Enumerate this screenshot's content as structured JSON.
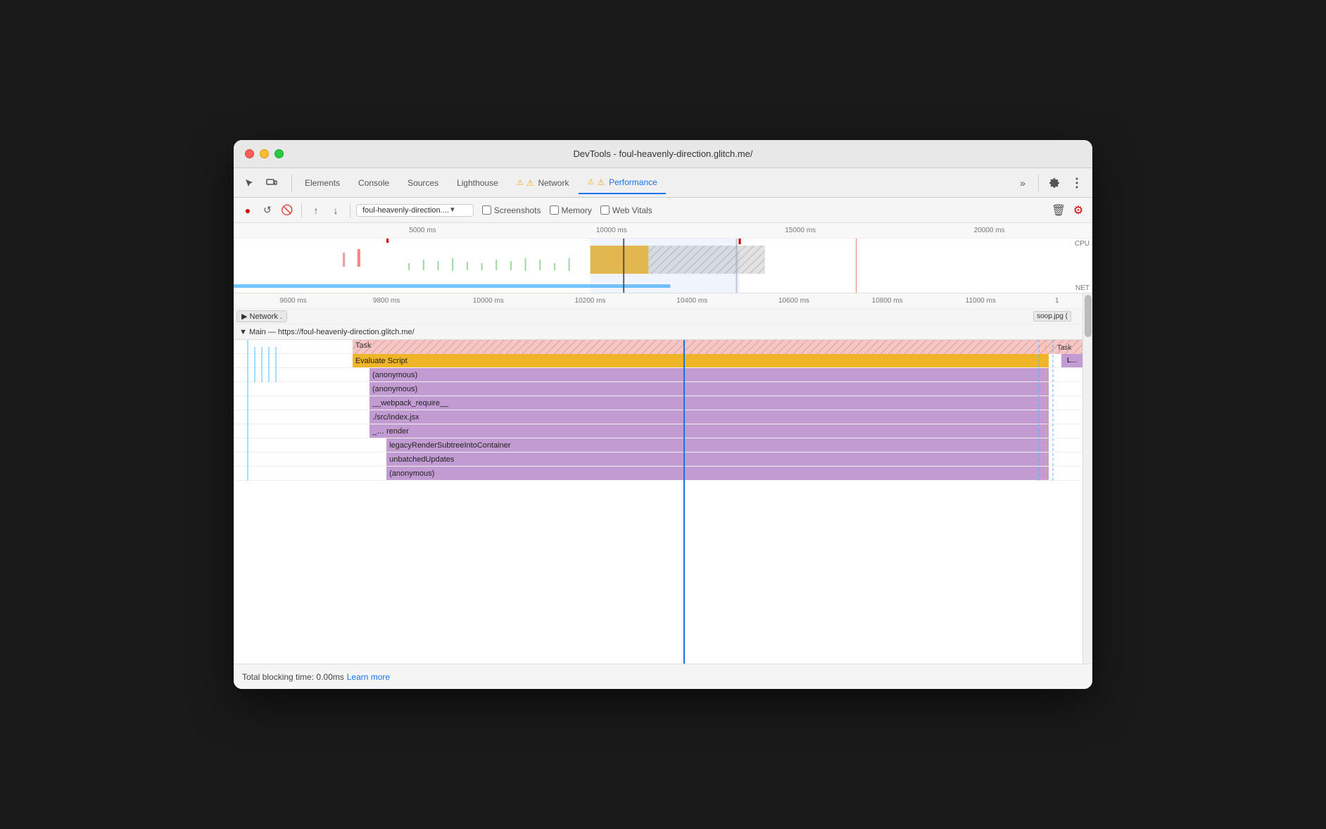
{
  "window": {
    "title": "DevTools - foul-heavenly-direction.glitch.me/"
  },
  "nav": {
    "tabs": [
      {
        "label": "Elements",
        "active": false,
        "warning": false
      },
      {
        "label": "Console",
        "active": false,
        "warning": false
      },
      {
        "label": "Sources",
        "active": false,
        "warning": false
      },
      {
        "label": "Lighthouse",
        "active": false,
        "warning": false
      },
      {
        "label": "Network",
        "active": false,
        "warning": true
      },
      {
        "label": "Performance",
        "active": true,
        "warning": true
      }
    ],
    "more_label": "»"
  },
  "toolbar": {
    "url": "foul-heavenly-direction....",
    "screenshots_label": "Screenshots",
    "memory_label": "Memory",
    "web_vitals_label": "Web Vitals"
  },
  "timeline": {
    "ruler_marks": [
      "5000 ms",
      "10000 ms",
      "15000 ms",
      "20000 ms"
    ],
    "flame_ruler_marks": [
      "9600 ms",
      "9800 ms",
      "10000 ms",
      "10200 ms",
      "10400 ms",
      "10600 ms",
      "10800 ms",
      "11000 ms",
      "1"
    ],
    "cpu_label": "CPU",
    "net_label": "NET"
  },
  "network_row": {
    "label": "▶ Network .",
    "soop_label": "soop.jpg ("
  },
  "main_section": {
    "title": "▼ Main — https://foul-heavenly-direction.glitch.me/",
    "rows": [
      {
        "label": "Task",
        "color": "#f4a7a7",
        "pattern": "diagonal",
        "indent": 0
      },
      {
        "label": "Evaluate Script",
        "color": "#f0b429",
        "indent": 0
      },
      {
        "label": "(anonymous)",
        "color": "#c39bd3",
        "indent": 1
      },
      {
        "label": "(anonymous)",
        "color": "#c39bd3",
        "indent": 1
      },
      {
        "label": "__webpack_require__",
        "color": "#c39bd3",
        "indent": 1
      },
      {
        "label": "./src/index.jsx",
        "color": "#c39bd3",
        "indent": 1
      },
      {
        "label": "_…   render",
        "color": "#c39bd3",
        "indent": 1
      },
      {
        "label": "legacyRenderSubtreeIntoContainer",
        "color": "#c39bd3",
        "indent": 2
      },
      {
        "label": "unbatchedUpdates",
        "color": "#c39bd3",
        "indent": 2
      },
      {
        "label": "(anonymous)",
        "color": "#c39bd3",
        "indent": 2
      }
    ]
  },
  "bottom": {
    "blocking_time": "Total blocking time: 0.00ms",
    "learn_more": "Learn more"
  }
}
